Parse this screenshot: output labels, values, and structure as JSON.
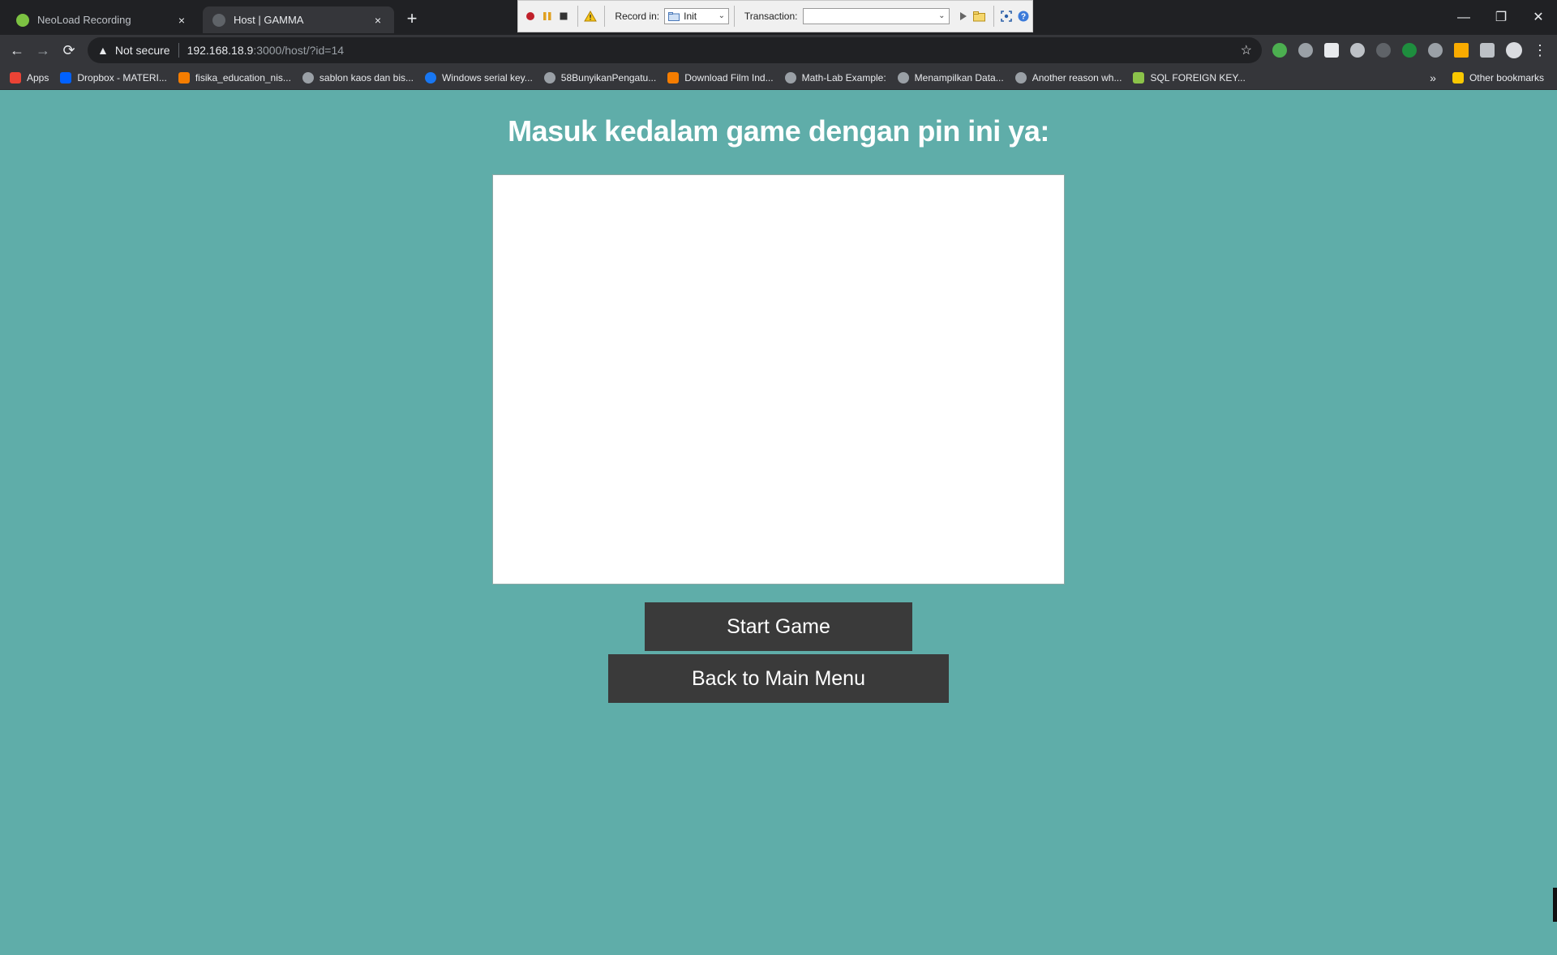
{
  "tabs": [
    {
      "title": "NeoLoad Recording",
      "close": "×"
    },
    {
      "title": "Host | GAMMA",
      "close": "×"
    }
  ],
  "new_tab": "+",
  "window_controls": {
    "minimize": "—",
    "restore": "❐",
    "close": "✕"
  },
  "neoload": {
    "record_in_label": "Record in:",
    "record_in_value": "Init",
    "transaction_label": "Transaction:",
    "transaction_value": ""
  },
  "nav": {
    "back": "←",
    "forward": "→",
    "reload": "⟳"
  },
  "address": {
    "security": "Not secure",
    "host": "192.168.18.9",
    "rest": ":3000/host/?id=14"
  },
  "bookmarks": [
    {
      "label": "Apps",
      "color": "#ea4335"
    },
    {
      "label": "Dropbox - MATERI...",
      "color": "#0061ff"
    },
    {
      "label": "fisika_education_nis...",
      "color": "#f57d00"
    },
    {
      "label": "sablon kaos dan bis...",
      "color": "#9aa0a6"
    },
    {
      "label": "Windows serial key...",
      "color": "#1877f2"
    },
    {
      "label": "58BunyikanPengatu...",
      "color": "#9aa0a6"
    },
    {
      "label": "Download Film Ind...",
      "color": "#f57d00"
    },
    {
      "label": "Math-Lab Example:",
      "color": "#9aa0a6"
    },
    {
      "label": "Menampilkan Data...",
      "color": "#9aa0a6"
    },
    {
      "label": "Another reason wh...",
      "color": "#9aa0a6"
    },
    {
      "label": "SQL FOREIGN KEY...",
      "color": "#8bc34a"
    }
  ],
  "bookmarks_overflow": "»",
  "other_bookmarks": "Other bookmarks",
  "page": {
    "heading": "Masuk kedalam game dengan pin ini ya:",
    "start_button": "Start Game",
    "back_button": "Back to Main Menu"
  },
  "colors": {
    "page_bg": "#5fada9",
    "button_bg": "#3a3a3a"
  }
}
